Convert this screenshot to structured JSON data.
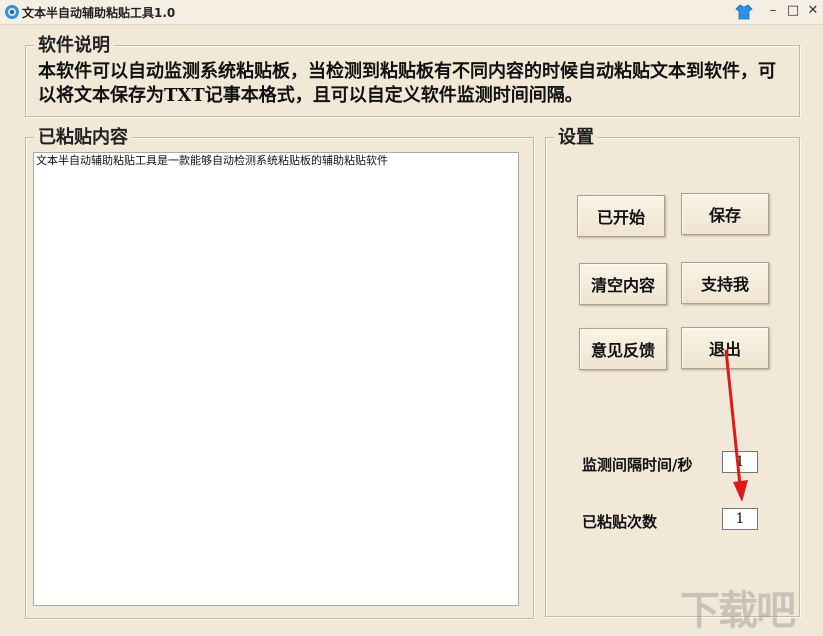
{
  "window": {
    "title": "文本半自动辅助粘贴工具1.0",
    "minimize": "–",
    "maximize": "□",
    "close": "✕"
  },
  "description": {
    "legend": "软件说明",
    "text": "本软件可以自动监测系统粘贴板，当检测到粘贴板有不同内容的时候自动粘贴文本到软件，可以将文本保存为TXT记事本格式，且可以自定义软件监测时间间隔。"
  },
  "content": {
    "legend": "已粘贴内容",
    "text": "文本半自动辅助粘贴工具是一款能够自动检测系统粘贴板的辅助粘贴软件"
  },
  "settings": {
    "legend": "设置",
    "buttons": {
      "start": "已开始",
      "save": "保存",
      "clear": "清空内容",
      "support": "支持我",
      "feedback": "意见反馈",
      "exit": "退出"
    },
    "interval_label": "监测间隔时间/秒",
    "interval_value": "1",
    "count_label": "已粘贴次数",
    "count_value": "1"
  },
  "watermark": "下载吧",
  "colors": {
    "background": "#f1e8d7",
    "annotation_arrow": "#e01818"
  },
  "icons": {
    "app": "app-logo-icon",
    "skin": "skin-shirt-icon"
  }
}
